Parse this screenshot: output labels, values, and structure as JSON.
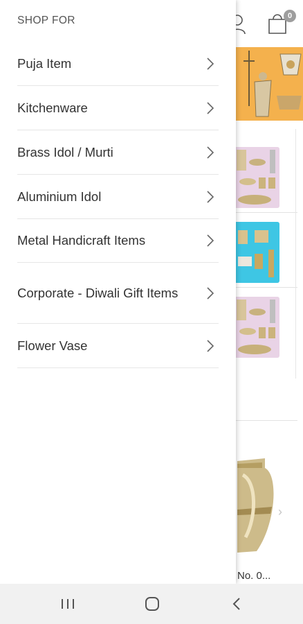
{
  "drawer": {
    "title": "SHOP FOR",
    "items": [
      {
        "label": "Puja Item"
      },
      {
        "label": "Kitchenware"
      },
      {
        "label": "Brass Idol / Murti"
      },
      {
        "label": "Aluminium Idol"
      },
      {
        "label": "Metal Handicraft Items"
      },
      {
        "label": "Corporate - Diwali Gift Items"
      },
      {
        "label": "Flower Vase"
      }
    ]
  },
  "header": {
    "cart_count": "0"
  },
  "background": {
    "product_name_partial": "No. 0..."
  },
  "icons": {
    "user": "user-icon",
    "cart": "shopping-bag-icon",
    "chevron": "chevron-right-icon",
    "nav_recents": "recent-apps-icon",
    "nav_home": "home-icon",
    "nav_back": "back-icon"
  },
  "colors": {
    "banner": "#f4b14d",
    "tile_pink": "#e9d3e6",
    "tile_blue": "#3ec6e4",
    "badge": "#9e9e9e"
  }
}
